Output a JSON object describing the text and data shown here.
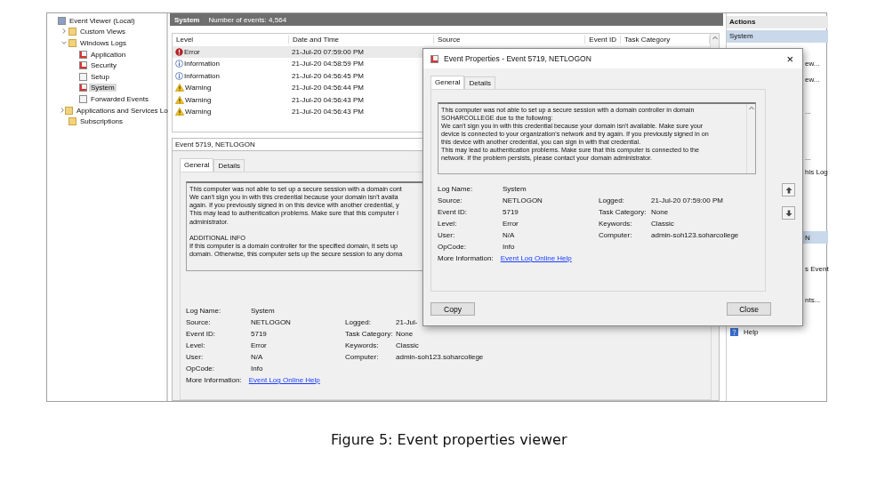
{
  "tree": [
    {
      "label": "Event Viewer (Local)",
      "kind": "root",
      "selected": false,
      "children": [
        {
          "label": "Custom Views",
          "kind": "folder",
          "expanded": false,
          "selected": false
        },
        {
          "label": "Windows Logs",
          "kind": "folder",
          "expanded": true,
          "selected": false,
          "children": [
            {
              "label": "Application",
              "kind": "log",
              "selected": false
            },
            {
              "label": "Security",
              "kind": "log",
              "selected": false
            },
            {
              "label": "Setup",
              "kind": "blank",
              "selected": false
            },
            {
              "label": "System",
              "kind": "log",
              "selected": true
            },
            {
              "label": "Forwarded Events",
              "kind": "blank",
              "selected": false
            }
          ]
        },
        {
          "label": "Applications and Services Lo",
          "kind": "folder",
          "expanded": false,
          "selected": false
        },
        {
          "label": "Subscriptions",
          "kind": "folder",
          "selected": false
        }
      ]
    }
  ],
  "log_header": {
    "title": "System",
    "count": "Number of events: 4,564"
  },
  "table": {
    "columns": [
      "Level",
      "Date and Time",
      "Source",
      "Event ID",
      "Task Category"
    ],
    "rows": [
      {
        "kind": "error",
        "level": "Error",
        "date": "21-Jul-20 07:59:00 PM",
        "selected": true
      },
      {
        "kind": "information",
        "level": "Information",
        "date": "21-Jul-20 04:58:59 PM",
        "selected": false
      },
      {
        "kind": "information",
        "level": "Information",
        "date": "21-Jul-20 04:56:45 PM",
        "selected": false
      },
      {
        "kind": "warning",
        "level": "Warning",
        "date": "21-Jul-20 04:56:44 PM",
        "selected": false
      },
      {
        "kind": "warning",
        "level": "Warning",
        "date": "21-Jul-20 04:56:43 PM",
        "selected": false
      },
      {
        "kind": "warning",
        "level": "Warning",
        "date": "21-Jul-20 04:56:43 PM",
        "selected": false
      }
    ]
  },
  "detail": {
    "title": "Event 5719, NETLOGON",
    "tabs": [
      {
        "label": "General",
        "selected": true
      },
      {
        "label": "Details",
        "selected": false
      }
    ],
    "paragraphs": [
      [
        "This computer was not able to set up a secure session with a domain cont",
        "We can't sign you in with this credential because your domain isn't availa",
        "again. If you previously signed in on this device with another credential, y",
        "This may lead to authentication problems. Make sure that this computer i",
        "administrator."
      ],
      [
        "ADDITIONAL INFO",
        "If this computer is a domain controller for the specified domain, it sets up",
        "domain. Otherwise, this computer sets up the secure session to any doma"
      ]
    ],
    "rows": [
      {
        "left": {
          "label": "Log Name:",
          "value": "System"
        }
      },
      {
        "left": {
          "label": "Source:",
          "value": "NETLOGON"
        },
        "right": {
          "label": "Logged:",
          "value": "21-Jul-"
        }
      },
      {
        "left": {
          "label": "Event ID:",
          "value": "5719"
        },
        "right": {
          "label": "Task Category:",
          "value": "None"
        }
      },
      {
        "left": {
          "label": "Level:",
          "value": "Error"
        },
        "right": {
          "label": "Keywords:",
          "value": "Classic"
        }
      },
      {
        "left": {
          "label": "User:",
          "value": "N/A"
        },
        "right": {
          "label": "Computer:",
          "value": "admin-soh123.soharcollege"
        }
      },
      {
        "left": {
          "label": "OpCode:",
          "value": "Info"
        }
      }
    ],
    "more_info": {
      "label": "More Information:",
      "link": "Event Log Online Help"
    }
  },
  "actions": {
    "title": "Actions",
    "section": "System",
    "items": [
      {
        "label": "ew...",
        "selected": false
      },
      {
        "label": "ew...",
        "selected": false
      },
      {
        "label": "...",
        "selected": false
      },
      {
        "label": "...",
        "selected": false
      },
      {
        "label": "his Log",
        "selected": false
      },
      {
        "label": "N",
        "selected": true
      },
      {
        "label": "s Event",
        "selected": false
      },
      {
        "label": "nts...",
        "selected": false
      },
      {
        "label": "Help",
        "kind": "help",
        "selected": false
      }
    ]
  },
  "dialog": {
    "title": "Event Properties - Event 5719, NETLOGON",
    "close": "×",
    "tabs": [
      {
        "label": "General",
        "selected": true
      },
      {
        "label": "Details",
        "selected": false
      }
    ],
    "message": [
      "This computer was not able to set up a secure session with a domain controller in domain",
      "SOHARCOLLEGE due to the following:",
      "We can't sign you in with this credential because your domain isn't available. Make sure your",
      "device is connected to your organization's network and try again. If you previously signed in on",
      "this device with another credential, you can sign in with that credential.",
      "This may lead to authentication problems. Make sure that this computer is connected to the",
      "network. If the problem persists, please contact your domain administrator."
    ],
    "rows": [
      {
        "left": {
          "label": "Log Name:",
          "value": "System"
        }
      },
      {
        "left": {
          "label": "Source:",
          "value": "NETLOGON"
        },
        "right": {
          "label": "Logged:",
          "value": "21-Jul-20 07:59:00 PM"
        }
      },
      {
        "left": {
          "label": "Event ID:",
          "value": "5719"
        },
        "right": {
          "label": "Task Category:",
          "value": "None"
        }
      },
      {
        "left": {
          "label": "Level:",
          "value": "Error"
        },
        "right": {
          "label": "Keywords:",
          "value": "Classic"
        }
      },
      {
        "left": {
          "label": "User:",
          "value": "N/A"
        },
        "right": {
          "label": "Computer:",
          "value": "admin-soh123.soharcollege"
        }
      },
      {
        "left": {
          "label": "OpCode:",
          "value": "Info"
        }
      }
    ],
    "more_info": {
      "label": "More Information:",
      "link": "Event Log Online Help"
    },
    "buttons": [
      "Copy",
      "Close"
    ]
  },
  "caption": "Figure 5: Event properties viewer"
}
